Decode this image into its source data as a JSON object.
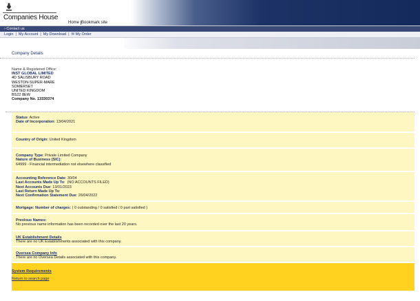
{
  "header": {
    "logo_text": "Companies House",
    "home_label": "Home",
    "bookmark_label": "Bookmark site"
  },
  "nav": {
    "contact_label": "› Contact us",
    "links": [
      "Login",
      "My Account",
      "My Download",
      "✉ My Order"
    ]
  },
  "page_title": "Company Details",
  "office": {
    "label": "Name & Registered Office:",
    "company_name": "INST GLOBAL LIMITED",
    "address": [
      "4D SALISBURY ROAD",
      "WESTON-SUPER-MARE",
      "SOMERSET",
      "UNITED KINGDOM",
      "BS22 8EW"
    ],
    "company_no_label": "Company No.",
    "company_no": "13330374"
  },
  "status": {
    "status_label": "Status",
    "status_value": "Active",
    "incorporation_label": "Date of Incorporation",
    "incorporation_value": "13/04/2021"
  },
  "origin": {
    "label": "Country of Origin",
    "value": "United Kingdom"
  },
  "company_type": {
    "type_label": "Company Type",
    "type_value": "Private Limited Company",
    "nature_label": "Nature of Business (SIC)",
    "nature_value": "64999 - Financial intermediation not elsewhere classified"
  },
  "accounts": {
    "ref_label": "Accounting Reference Date",
    "ref_value": "30/04",
    "last_label": "Last Accounts Made Up To",
    "last_value": "(NO ACCOUNTS FILED)",
    "next_label": "Next Accounts Due",
    "next_value": "13/01/2023",
    "return_label": "Last Return Made Up To",
    "return_value": "",
    "confirm_label": "Next Confirmation Statement Due",
    "confirm_value": "26/04/2022"
  },
  "mortgage": {
    "label": "Mortgage: Number of charges:",
    "value": "( 0 outstanding / 0 satisfied / 0 part satisfied )"
  },
  "previous_names": {
    "label": "Previous Names:",
    "value": "No previous name information has been recorded over the last 20 years."
  },
  "uk_establishment": {
    "link": "UK Establishment Details",
    "value": "There are no UK Establishments associated with this company."
  },
  "overseas": {
    "link": "Oversea Company Info",
    "value": "There are no Oversea Details associated with this company."
  },
  "footer": {
    "system_requirements": "System Requirements",
    "return_search": "Return to search page"
  }
}
